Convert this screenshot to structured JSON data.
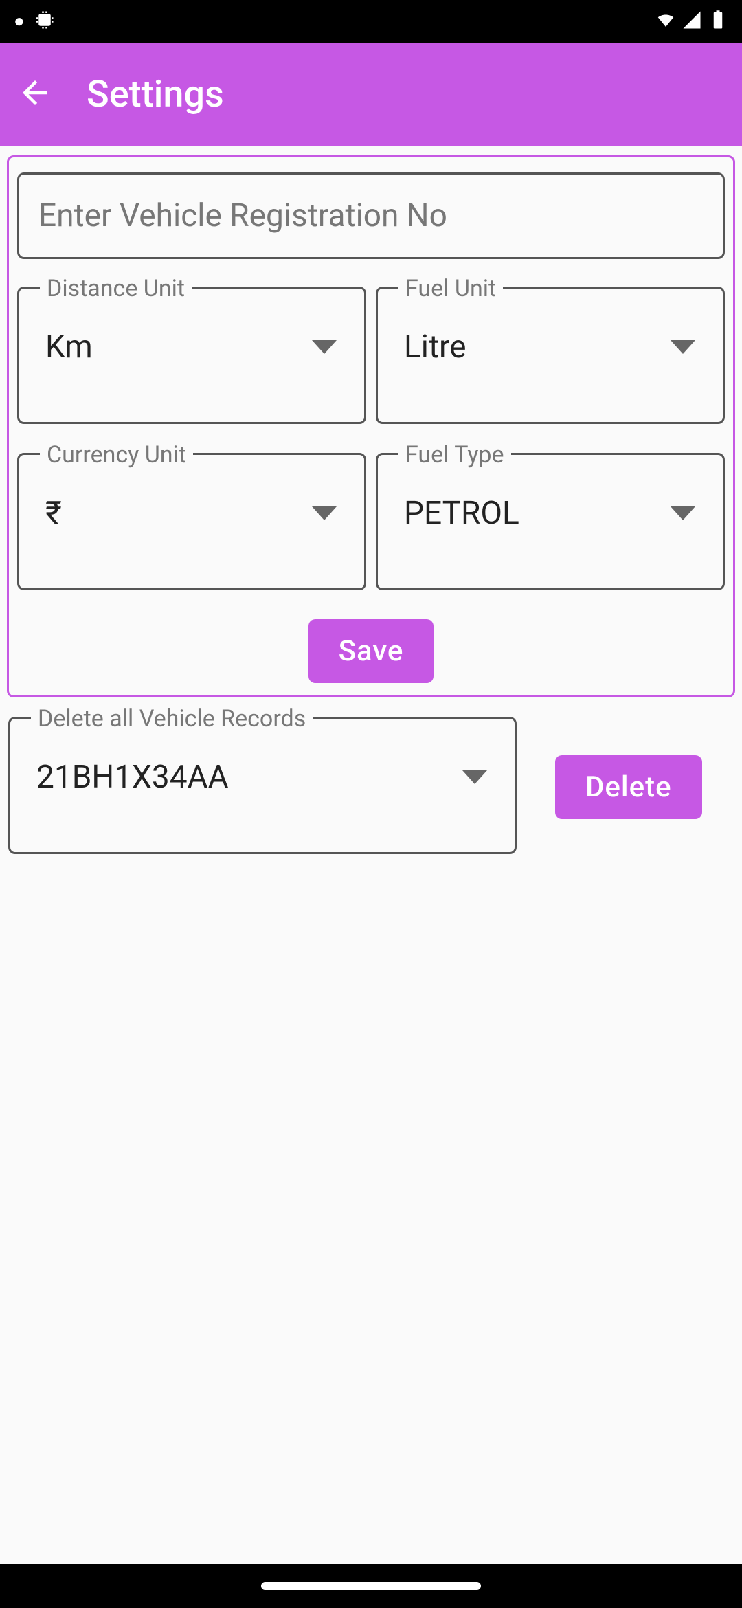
{
  "status": {
    "wifi_icon": "wifi",
    "signal_icon": "signal",
    "battery_icon": "battery"
  },
  "header": {
    "title": "Settings"
  },
  "form": {
    "reg_placeholder": "Enter Vehicle Registration No",
    "distance_label": "Distance Unit",
    "distance_value": "Km",
    "fuel_unit_label": "Fuel Unit",
    "fuel_unit_value": "Litre",
    "currency_label": "Currency Unit",
    "currency_value": "₹",
    "fuel_type_label": "Fuel Type",
    "fuel_type_value": "PETROL",
    "save_label": "Save"
  },
  "delete_section": {
    "label": "Delete all Vehicle Records",
    "selected_vehicle": "21BH1X34AA",
    "delete_label": "Delete"
  }
}
